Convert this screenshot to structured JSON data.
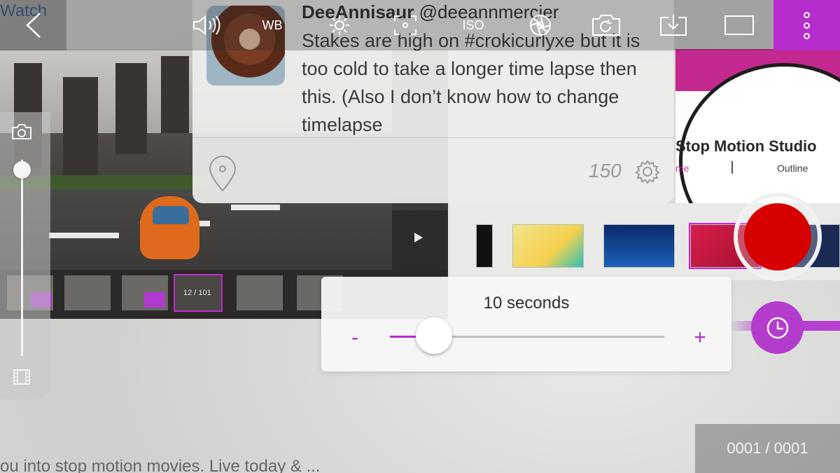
{
  "background": {
    "watch_label": "Watch",
    "presentation_title": "Stop Motion Studio",
    "tab_home": "me",
    "tab_outline": "Outline",
    "strip_counter": "12 / 101",
    "bottom_text": "ou into stop motion movies. Live today & ..."
  },
  "toolbar": {
    "back_icon": "chevron-left-icon",
    "volume_icon": "volume-icon",
    "wb_label": "WB",
    "exposure_icon": "sun-icon",
    "focus_icon": "focus-icon",
    "iso_label": "ISO",
    "aperture_icon": "aperture-icon",
    "switch_camera_icon": "camera-rotate-icon",
    "import_icon": "download-icon",
    "aspect_icon": "aspect-ratio-icon",
    "menu_icon": "more-vertical-icon",
    "accent_color": "#b62ccc"
  },
  "tweet": {
    "name": "DeeAnnisaur",
    "handle": "@deeannmercier",
    "text": "Stakes are high on #crokicurlyxe but it is too cold to take a longer time lapse then this. (Also I don’t know how to change timelapse",
    "char_count": "150"
  },
  "zoom": {
    "level": 0.05
  },
  "interval": {
    "label": "10 seconds",
    "minus_label": "-",
    "plus_label": "+",
    "slider_fraction": 0.16
  },
  "record": {
    "color": "#d60000"
  },
  "frame_counter": "0001 / 0001"
}
